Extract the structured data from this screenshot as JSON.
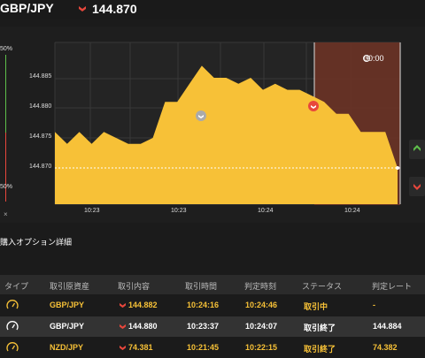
{
  "header": {
    "pair": "GBP/JPY",
    "price": "144.870"
  },
  "chart": {
    "y_ticks": [
      "144.885",
      "144.880",
      "144.875",
      "144.870"
    ],
    "x_ticks": [
      "10:23",
      "10:23",
      "10:24",
      "10:24"
    ],
    "side_top_pct": "50%",
    "side_bottom_pct": "50%",
    "side_close": "×",
    "timer": "00:00"
  },
  "chart_data": {
    "type": "area",
    "color": "#f7c137",
    "current_price": 144.87,
    "values": [
      144.876,
      144.874,
      144.876,
      144.874,
      144.876,
      144.875,
      144.874,
      144.874,
      144.875,
      144.881,
      144.881,
      144.884,
      144.887,
      144.885,
      144.885,
      144.884,
      144.885,
      144.883,
      144.884,
      144.883,
      144.883,
      144.882,
      144.881,
      144.879,
      144.879,
      144.876,
      144.876,
      144.876,
      144.87
    ]
  },
  "section": {
    "title": "購入オプション詳細"
  },
  "table": {
    "headers": [
      "タイプ",
      "取引原資産",
      "取引内容",
      "取引時間",
      "判定時刻",
      "ステータス",
      "判定レート"
    ],
    "rows": [
      {
        "asset": "GBP/JPY",
        "price": "144.882",
        "time": "10:24:16",
        "judge": "10:24:46",
        "status": "取引中",
        "rate": "-",
        "color": "#f7c137",
        "bg": "#1b1b1b"
      },
      {
        "asset": "GBP/JPY",
        "price": "144.880",
        "time": "10:23:37",
        "judge": "10:24:07",
        "status": "取引終了",
        "rate": "144.884",
        "color": "#ffffff",
        "bg": "#333333"
      },
      {
        "asset": "NZD/JPY",
        "price": "74.381",
        "time": "10:21:45",
        "judge": "10:22:15",
        "status": "取引終了",
        "rate": "74.382",
        "color": "#f7c137",
        "bg": "#1b1b1b"
      }
    ]
  },
  "colors": {
    "accent": "#f7c137",
    "down": "#e8473c",
    "up": "#5fbf4b"
  }
}
